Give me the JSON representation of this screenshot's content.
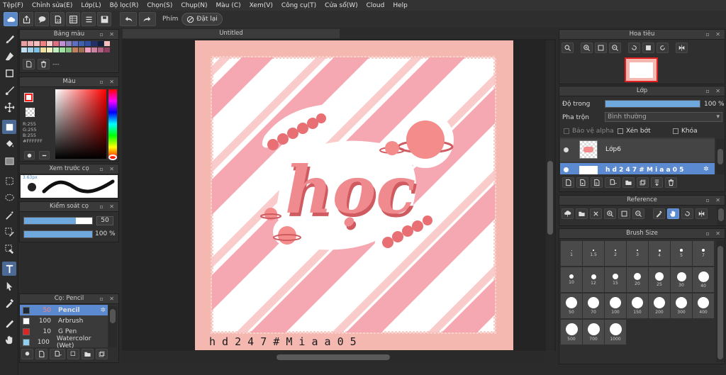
{
  "menu": [
    "Tệp(F)",
    "Chỉnh sửa(E)",
    "Lớp(L)",
    "Bộ lọc(R)",
    "Chọn(S)",
    "Chụp(N)",
    "Màu (C)",
    "Xem(V)",
    "Công cụ(T)",
    "Cửa sổ(W)",
    "Cloud",
    "Help"
  ],
  "toolbar": {
    "shortcut_label": "Phím",
    "reset_label": "Đặt lại"
  },
  "panels": {
    "palette": {
      "title": "Bảng màu",
      "page": "---"
    },
    "color": {
      "title": "Màu",
      "rgb": [
        "R:255",
        "G:255",
        "B:255"
      ],
      "hex": "#FFFFFF",
      "foreground": "#ff1a1a",
      "background": "#ffffff"
    },
    "brush_preview": {
      "title": "Xem trước cọ",
      "size_label": "3.63px"
    },
    "brush_control": {
      "title": "Kiểm soát cọ",
      "size": "50",
      "opacity": "100 %",
      "size_fraction": 0.76,
      "opacity_fraction": 1.0
    },
    "brushes": {
      "title": "Cọ: Pencil",
      "items": [
        {
          "size": "50",
          "name": "Pencil",
          "selected": true,
          "color": "#1e2a3a"
        },
        {
          "size": "100",
          "name": "Arbrush",
          "selected": false,
          "color": "#ffffff"
        },
        {
          "size": "10",
          "name": "G Pen",
          "selected": false,
          "color": "#e02424"
        },
        {
          "size": "100",
          "name": "Watercolor (Wet)",
          "selected": false,
          "color": "#8fd0f0"
        }
      ]
    },
    "navigator": {
      "title": "Hoa tiêu"
    },
    "layers": {
      "title": "Lớp",
      "opacity_label": "Độ trong",
      "opacity_value": "100 %",
      "opacity_fraction": 1.0,
      "blend_label": "Pha trộn",
      "blend_value": "Bình thường",
      "protect_alpha": "Bảo vệ alpha",
      "clipping": "Xén bớt",
      "lock": "Khóa",
      "items": [
        {
          "name": "Lớp6",
          "selected": false
        },
        {
          "name": "h d 2 4 7 # M i a a 0 5",
          "selected": true
        }
      ]
    },
    "reference": {
      "title": "Reference"
    },
    "brush_size": {
      "title": "Brush Size",
      "sizes": [
        "1",
        "1.5",
        "2",
        "3",
        "4",
        "5",
        "7",
        "10",
        "12",
        "15",
        "20",
        "25",
        "30",
        "40",
        "50",
        "70",
        "100",
        "150",
        "200",
        "300",
        "400",
        "500",
        "700",
        "1000"
      ]
    }
  },
  "document": {
    "tab_title": "Untitled",
    "signature": "h d 2 4 7 # M i a a 0 5",
    "artwork_text": "học",
    "colors": {
      "paper": "#f4b8b0",
      "stripe": "#f5a4ad",
      "white": "#ffffff",
      "letter": "#ef7f85",
      "letter_shadow": "#cf5a60",
      "planet": "#f48c8c"
    }
  },
  "colors": {
    "accent": "#5b8ad0",
    "panel": "#2f2f2f",
    "selected_row": "#5b8ad0"
  }
}
